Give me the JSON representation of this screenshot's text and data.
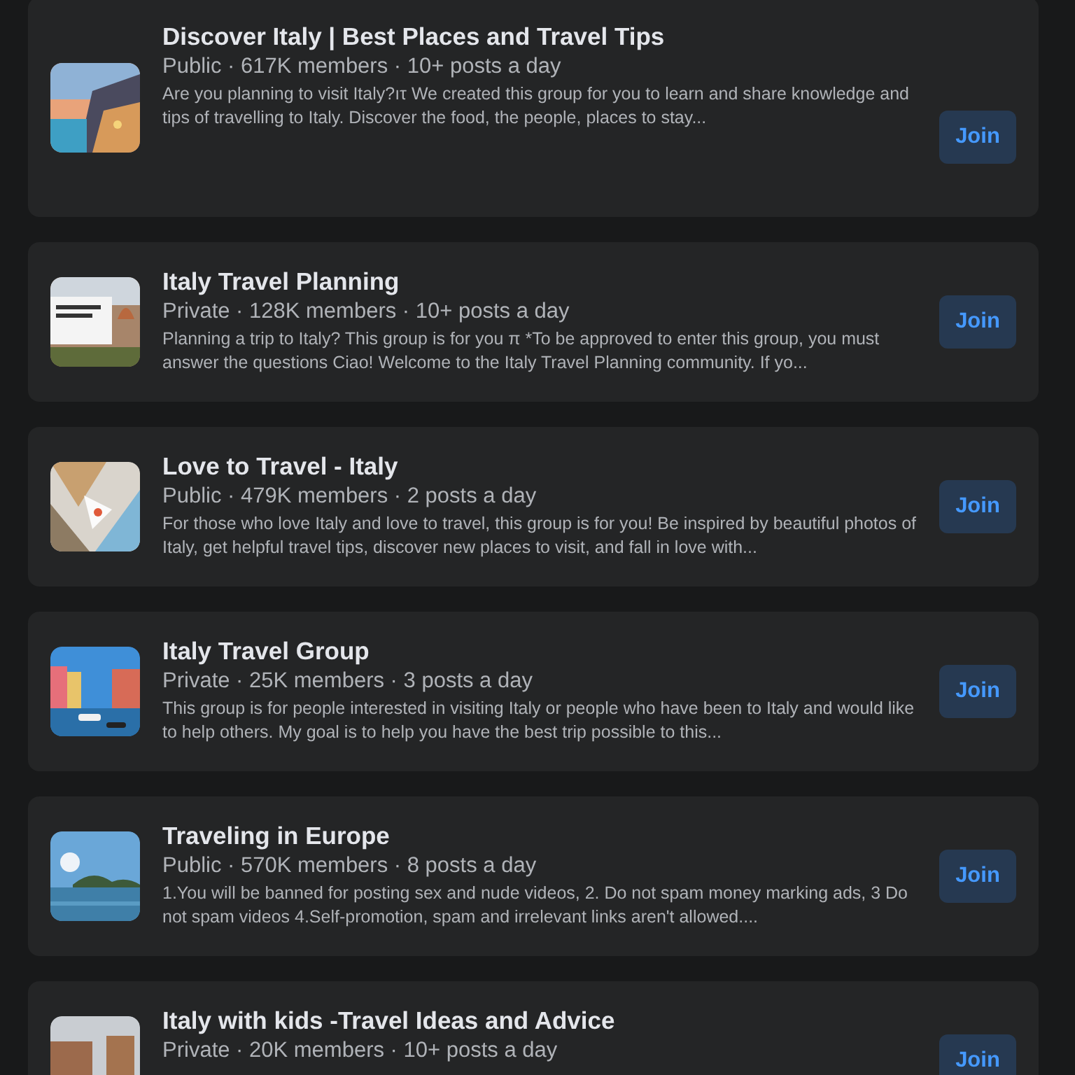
{
  "groups": [
    {
      "name": "Discover Italy | Best Places and Travel Tips",
      "meta": "Public · 617K members · 10+ posts a day",
      "description": "Are you planning to visit Italy?ıτ We created this group for you to learn and share knowledge and tips of travelling to Italy. Discover the food, the people, places to stay...",
      "button": "Join"
    },
    {
      "name": "Italy Travel Planning",
      "meta": "Private · 128K members · 10+ posts a day",
      "description": "Planning a trip to Italy? This group is for you π *To be approved to enter this group, you must answer the questions Ciao! Welcome to the Italy Travel Planning community. If yo...",
      "button": "Join"
    },
    {
      "name": "Love to Travel - Italy",
      "meta": "Public · 479K members · 2 posts a day",
      "description": "For those who love Italy and love to travel, this group is for you! Be inspired by beautiful photos of Italy, get helpful travel tips, discover new places to visit, and fall in love with...",
      "button": "Join"
    },
    {
      "name": "Italy Travel Group",
      "meta": "Private · 25K members · 3 posts a day",
      "description": "This group is for people interested in visiting Italy or people who have been to Italy and would like to help others. My goal is to help you have the best trip possible to this...",
      "button": "Join"
    },
    {
      "name": "Traveling in Europe",
      "meta": "Public · 570K members · 8 posts a day",
      "description": "1.You will be banned for posting sex and nude videos, 2. Do not spam money marking ads, 3 Do not spam videos 4.Self-promotion, spam and irrelevant links aren't allowed....",
      "button": "Join"
    },
    {
      "name": "Italy with kids -Travel Ideas and Advice",
      "meta": "Private · 20K members · 10+ posts a day",
      "button": "Join"
    }
  ]
}
